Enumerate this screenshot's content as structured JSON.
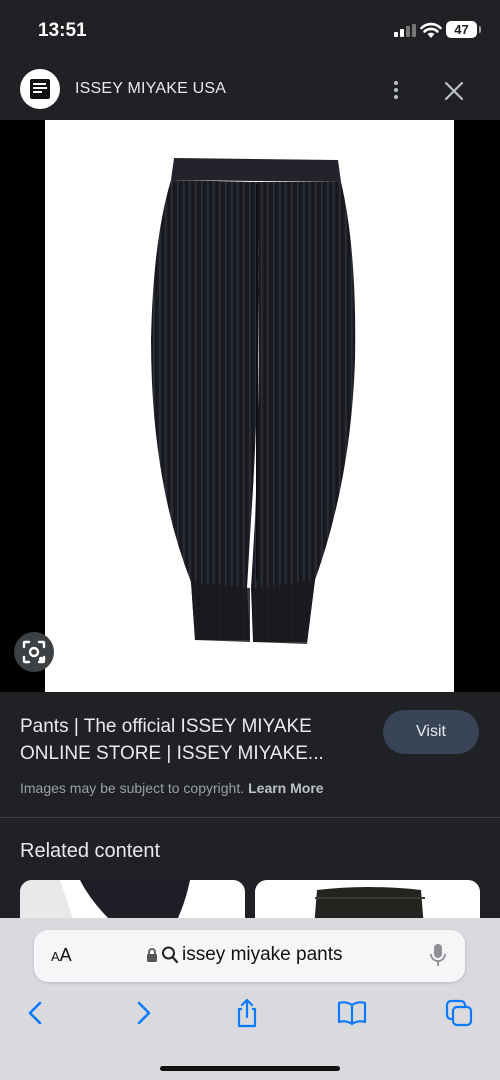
{
  "status_bar": {
    "time": "13:51",
    "battery_level": "47"
  },
  "site_header": {
    "site_name": "ISSEY MIYAKE USA",
    "logo_text": "ISSEY MIYAKE"
  },
  "result": {
    "title_line1": "Pants | The official ISSEY MIYAKE",
    "title_line2": "ONLINE STORE | ISSEY MIYAKE...",
    "visit_label": "Visit",
    "copyright_text": "Images may be subject to copyright.",
    "learn_more_label": "Learn More"
  },
  "related": {
    "heading": "Related content"
  },
  "safari": {
    "aa_label_small": "A",
    "aa_label_large": "A",
    "url_text": "issey miyake pants"
  },
  "icons": {
    "more": "more-vert-icon",
    "close": "close-icon",
    "lens": "lens-icon",
    "back": "chevron-left-icon",
    "forward": "chevron-right-icon",
    "share": "share-icon",
    "bookmarks": "book-icon",
    "tabs": "tabs-icon",
    "lock": "lock-icon",
    "search": "search-icon",
    "mic": "mic-icon"
  },
  "colors": {
    "background": "#202124",
    "visit_button": "#394457",
    "safari_accent": "#0a7aff",
    "toolbar_bg": "#d9d9de"
  }
}
